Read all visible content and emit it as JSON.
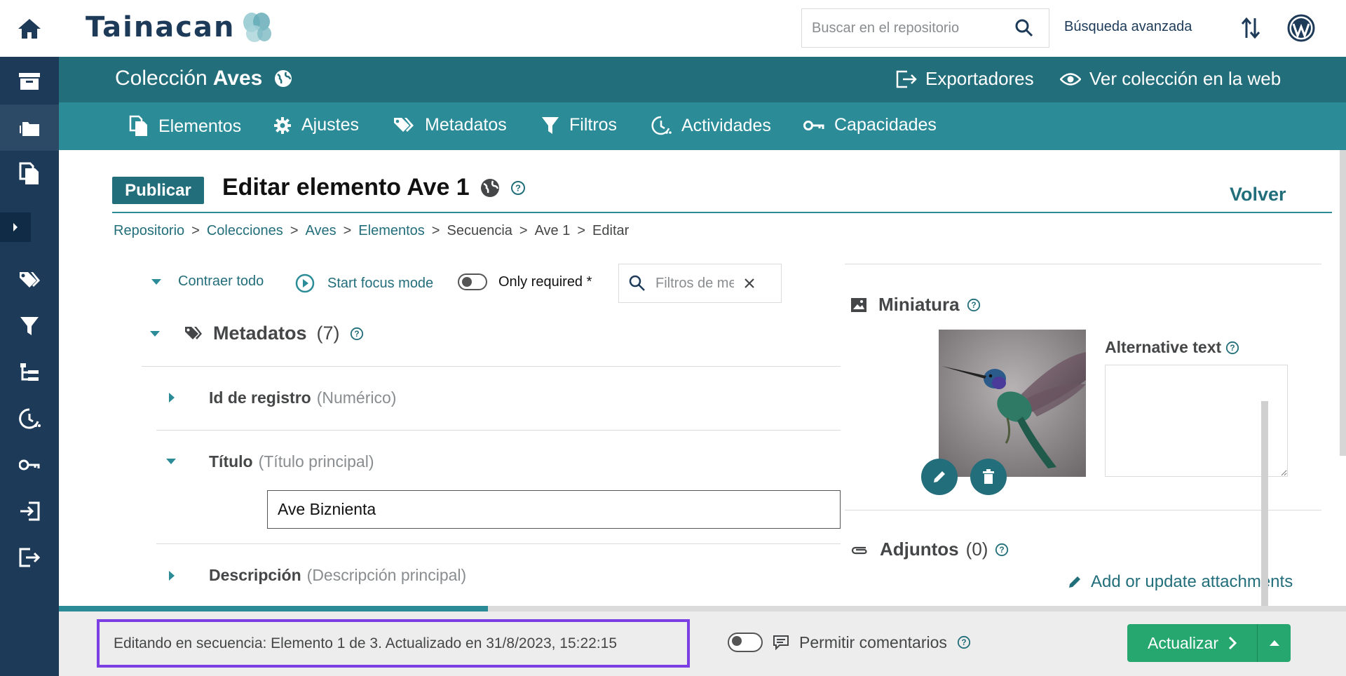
{
  "app": {
    "logo_text": "Tainacan",
    "search_placeholder": "Buscar en el repositorio",
    "advanced_search": "Búsqueda avanzada"
  },
  "sidebar": {
    "items": [
      {
        "name": "home-icon"
      },
      {
        "name": "archive-icon"
      },
      {
        "name": "collections-icon"
      },
      {
        "name": "items-icon"
      },
      {
        "name": "expand-icon"
      },
      {
        "name": "tags-icon"
      },
      {
        "name": "filter-icon"
      },
      {
        "name": "taxonomies-icon"
      },
      {
        "name": "activities-icon"
      },
      {
        "name": "key-icon"
      },
      {
        "name": "import-icon"
      },
      {
        "name": "export-icon"
      }
    ]
  },
  "collection": {
    "label": "Colección",
    "name": "Aves",
    "exporters": "Exportadores",
    "view_web": "Ver colección en la web"
  },
  "tabs": [
    {
      "label": "Elementos"
    },
    {
      "label": "Ajustes"
    },
    {
      "label": "Metadatos"
    },
    {
      "label": "Filtros"
    },
    {
      "label": "Actividades"
    },
    {
      "label": "Capacidades"
    }
  ],
  "page": {
    "publish_label": "Publicar",
    "title": "Editar elemento Ave 1",
    "back_label": "Volver"
  },
  "breadcrumb": [
    {
      "label": "Repositorio",
      "link": true
    },
    {
      "label": "Colecciones",
      "link": true
    },
    {
      "label": "Aves",
      "link": true
    },
    {
      "label": "Elementos",
      "link": true
    },
    {
      "label": "Secuencia",
      "link": false
    },
    {
      "label": "Ave 1",
      "link": false
    },
    {
      "label": "Editar",
      "link": false
    }
  ],
  "controls": {
    "collapse_all": "Contraer todo",
    "focus_mode": "Start focus mode",
    "only_required": "Only required *",
    "filter_placeholder": "Filtros de metadatos"
  },
  "metadata_section": {
    "title": "Metadatos",
    "count": "(7)",
    "fields": [
      {
        "name": "Id de registro",
        "type": "(Numérico)"
      },
      {
        "name": "Título",
        "type": "(Título principal)",
        "value": "Ave Biznienta"
      },
      {
        "name": "Descripción",
        "type": "(Descripción principal)"
      }
    ]
  },
  "thumbnail": {
    "title": "Miniatura",
    "alt_text_label": "Alternative text"
  },
  "attachments": {
    "title": "Adjuntos",
    "count": "(0)",
    "add_link": "Add or update attachments"
  },
  "progress": {
    "fraction": 0.3333
  },
  "footer": {
    "status": "Editando en secuencia: Elemento 1 de 3. Actualizado en 31/8/2023, 15:22:15",
    "allow_comments": "Permitir comentarios",
    "update_label": "Actualizar"
  },
  "colors": {
    "rail": "#1d3b59",
    "collection_header": "#236e7b",
    "tabs": "#2b8c98",
    "update_button": "#25a76f",
    "status_highlight": "#7b3fe4"
  }
}
